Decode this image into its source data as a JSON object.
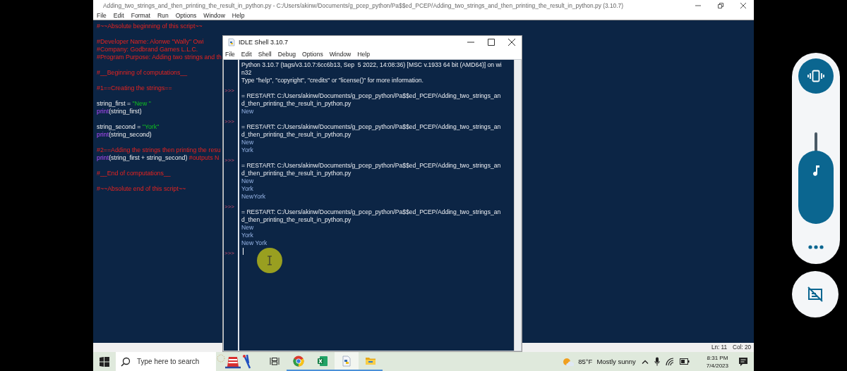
{
  "editor": {
    "title": "Adding_two_strings_and_then_printing_the_result_in_python.py - C:/Users/akinw/Documents/g_pcep_python/Pa$$ed_PCEP/Adding_two_strings_and_then_printing_the_result_in_python.py (3.10.7)",
    "menu": [
      "File",
      "Edit",
      "Format",
      "Run",
      "Options",
      "Window",
      "Help"
    ],
    "blocks": [
      [
        [
          {
            "kind": "comment",
            "text": "#~~Absolute beginning of this script~~"
          }
        ]
      ],
      [
        [
          {
            "kind": "comment",
            "text": "#Developer Name: Alonwe \"Wally\" Owi"
          }
        ],
        [
          {
            "kind": "comment",
            "text": "#Company: Godbrand Games L.L.C."
          }
        ],
        [
          {
            "kind": "comment",
            "text": "#Program Purpose: Adding two strings and th"
          }
        ]
      ],
      [
        [
          {
            "kind": "comment",
            "text": "#__Beginning of computations__"
          }
        ]
      ],
      [
        [
          {
            "kind": "comment",
            "text": "#1==Creating the strings=="
          }
        ]
      ],
      [
        [
          {
            "kind": "code",
            "text": "string_first = "
          },
          {
            "kind": "string",
            "text": "\"New \""
          }
        ],
        [
          {
            "kind": "builtin",
            "text": "print"
          },
          {
            "kind": "code",
            "text": "(string_first)"
          }
        ]
      ],
      [
        [
          {
            "kind": "code",
            "text": "string_second = "
          },
          {
            "kind": "string",
            "text": "\"York\""
          }
        ],
        [
          {
            "kind": "builtin",
            "text": "print"
          },
          {
            "kind": "code",
            "text": "(string_second)"
          }
        ]
      ],
      [
        [
          {
            "kind": "comment",
            "text": "#2==Adding the strings then printing the resu"
          }
        ],
        [
          {
            "kind": "builtin",
            "text": "print"
          },
          {
            "kind": "code",
            "text": "(string_first + string_second) "
          },
          {
            "kind": "comment",
            "text": "#outputs N"
          }
        ]
      ],
      [
        [
          {
            "kind": "comment",
            "text": "#__End of computations__"
          }
        ]
      ],
      [
        [
          {
            "kind": "comment",
            "text": "#~~Absolute end of this script~~"
          }
        ]
      ]
    ],
    "status": {
      "line": "Ln: 11",
      "col": "Col: 20"
    }
  },
  "shell": {
    "title": "IDLE Shell 3.10.7",
    "menu": [
      "File",
      "Edit",
      "Shell",
      "Debug",
      "Options",
      "Window",
      "Help"
    ],
    "lines": [
      {
        "kind": "info",
        "text": "Python 3.10.7 (tags/v3.10.7:6cc6b13, Sep  5 2022, 14:08:36) [MSC v.1933 64 bit (AMD64)] on wi"
      },
      {
        "kind": "info",
        "text": "n32"
      },
      {
        "kind": "info",
        "text": "Type \"help\", \"copyright\", \"credits\" or \"license()\" for more information."
      },
      {
        "prompt": ">>>"
      },
      {
        "kind": "info",
        "text": "= RESTART: C:/Users/akinw/Documents/g_pcep_python/Pa$$ed_PCEP/Adding_two_strings_an"
      },
      {
        "kind": "info",
        "text": "d_then_printing_the_result_in_python.py"
      },
      {
        "kind": "stdout",
        "text": "New"
      },
      {
        "prompt": ">>>"
      },
      {
        "kind": "info",
        "text": "= RESTART: C:/Users/akinw/Documents/g_pcep_python/Pa$$ed_PCEP/Adding_two_strings_an"
      },
      {
        "kind": "info",
        "text": "d_then_printing_the_result_in_python.py"
      },
      {
        "kind": "stdout",
        "text": "New"
      },
      {
        "kind": "stdout",
        "text": "York"
      },
      {
        "prompt": ">>>"
      },
      {
        "kind": "info",
        "text": "= RESTART: C:/Users/akinw/Documents/g_pcep_python/Pa$$ed_PCEP/Adding_two_strings_an"
      },
      {
        "kind": "info",
        "text": "d_then_printing_the_result_in_python.py"
      },
      {
        "kind": "stdout",
        "text": "New"
      },
      {
        "kind": "stdout",
        "text": "York"
      },
      {
        "kind": "stdout",
        "text": "NewYork"
      },
      {
        "prompt": ">>>"
      },
      {
        "kind": "info",
        "text": "= RESTART: C:/Users/akinw/Documents/g_pcep_python/Pa$$ed_PCEP/Adding_two_strings_an"
      },
      {
        "kind": "info",
        "text": "d_then_printing_the_result_in_python.py"
      },
      {
        "kind": "stdout",
        "text": "New"
      },
      {
        "kind": "stdout",
        "text": "York"
      },
      {
        "kind": "stdout",
        "text": "New York"
      },
      {
        "prompt": ">>>",
        "caret": true
      }
    ]
  },
  "taskbar": {
    "search": {
      "placeholder": "Type here to search"
    },
    "apps": [
      {
        "kind": "task-view",
        "running": false,
        "selected": false
      },
      {
        "kind": "chrome",
        "running": true,
        "selected": false
      },
      {
        "kind": "excel",
        "running": true,
        "selected": false
      },
      {
        "kind": "python",
        "running": true,
        "selected": true
      },
      {
        "kind": "explorer",
        "running": true,
        "selected": false
      }
    ],
    "weather": {
      "temp": "85°F",
      "condition": "Mostly sunny"
    },
    "time": "8:31 PM",
    "date": "7/4/2023"
  },
  "volume_panel": {
    "vibrate": {
      "selected": true
    },
    "media": {
      "level": 0.8
    }
  }
}
